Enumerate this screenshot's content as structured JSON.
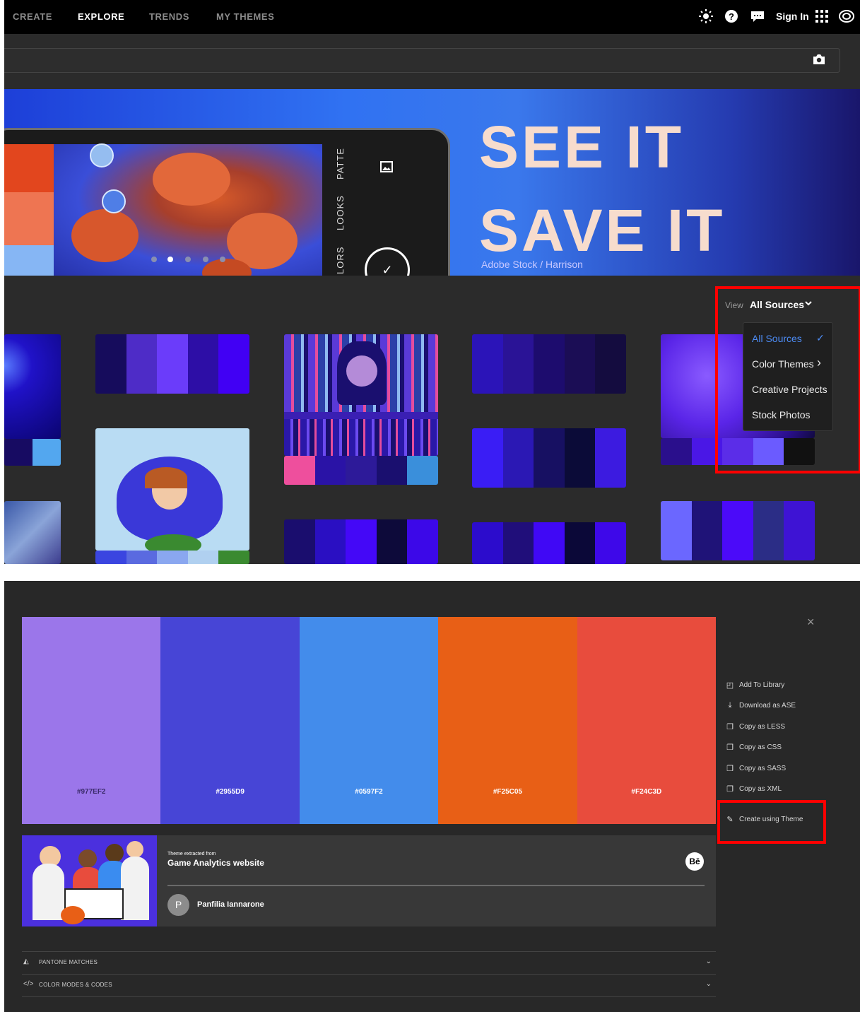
{
  "nav": {
    "items": [
      "CREATE",
      "EXPLORE",
      "TRENDS",
      "MY THEMES"
    ],
    "active": "EXPLORE",
    "signin": "Sign In"
  },
  "hero": {
    "line1": "SEE IT",
    "line2": "SAVE IT",
    "credit": "Adobe Stock / Harrison",
    "tab_patterns": "PATTE",
    "tab_looks": "LOOKS",
    "tab_colors": "LORS"
  },
  "view": {
    "label": "View",
    "value": "All Sources",
    "options": [
      "All Sources",
      "Color Themes",
      "Creative Projects",
      "Stock Photos"
    ]
  },
  "tiles": {
    "t1": [
      "#160c5c",
      "#4e2cc7",
      "#6b3cfa",
      "#2d0ea6",
      "#4100f4"
    ],
    "t2": [
      "#2b14b8",
      "#2a1396",
      "#1d0c6e",
      "#1b0d55",
      "#140c3f"
    ],
    "t3": [
      "#3a1df5",
      "#2b18b4",
      "#171062",
      "#0b0b38",
      "#3c1be0"
    ],
    "t4": [
      "#1a0d6e",
      "#2a0fc2",
      "#4408f7",
      "#0d0a3a",
      "#3c08e8"
    ],
    "t5": [
      "#2c0ccc",
      "#200e7a",
      "#4008f5",
      "#0b0838",
      "#3e08e9"
    ],
    "t6": [
      "#6b67ff",
      "#1f1378",
      "#4b0af9",
      "#2b2d86",
      "#3e13d4"
    ],
    "jelly_strip": [
      "#170b62",
      "#53a7ef"
    ],
    "books_strip": [
      "#ee4f9d",
      "#2a13a6",
      "#2d1a99",
      "#1a0f6f",
      "#3a8fdb"
    ],
    "coral_strip": [
      "#2a0f8c",
      "#4a17e6",
      "#5b2de8",
      "#6b5bff",
      "#111111"
    ],
    "flower_strip": [
      "#3a45e0",
      "#5a6ae0",
      "#8aa7f0",
      "#b0d0f0",
      "#3a8a30"
    ]
  },
  "theme": {
    "colors": [
      {
        "hex": "#977EF2",
        "color": "#9b76ea"
      },
      {
        "hex": "#2955D9",
        "color": "#4745d6"
      },
      {
        "hex": "#0597F2",
        "color": "#438ceb"
      },
      {
        "hex": "#F25C05",
        "color": "#e85f16"
      },
      {
        "hex": "#F24C3D",
        "color": "#e84c3d"
      }
    ],
    "extracted_from": "Theme extracted from",
    "source_title": "Game Analytics website",
    "badge": "Bē",
    "author_initial": "P",
    "author": "Panfilia Iannarone",
    "actions": [
      {
        "icon": "library-icon",
        "glyph": "◰",
        "label": "Add To Library"
      },
      {
        "icon": "download-icon",
        "glyph": "⤓",
        "label": "Download as ASE"
      },
      {
        "icon": "copy-icon",
        "glyph": "❐",
        "label": "Copy as LESS"
      },
      {
        "icon": "copy-icon",
        "glyph": "❐",
        "label": "Copy as CSS"
      },
      {
        "icon": "copy-icon",
        "glyph": "❐",
        "label": "Copy as SASS"
      },
      {
        "icon": "copy-icon",
        "glyph": "❐",
        "label": "Copy as XML"
      },
      {
        "icon": "create-icon",
        "glyph": "✎",
        "label": "Create using Theme"
      }
    ],
    "accordions": [
      {
        "glyph": "◭",
        "label": "PANTONE MATCHES"
      },
      {
        "glyph": "</>",
        "label": "COLOR MODES & CODES"
      }
    ]
  },
  "icons": {
    "close": "×",
    "chevron_down": "⌄",
    "chevron_right": "›",
    "check": "✓",
    "camera": "📷"
  }
}
